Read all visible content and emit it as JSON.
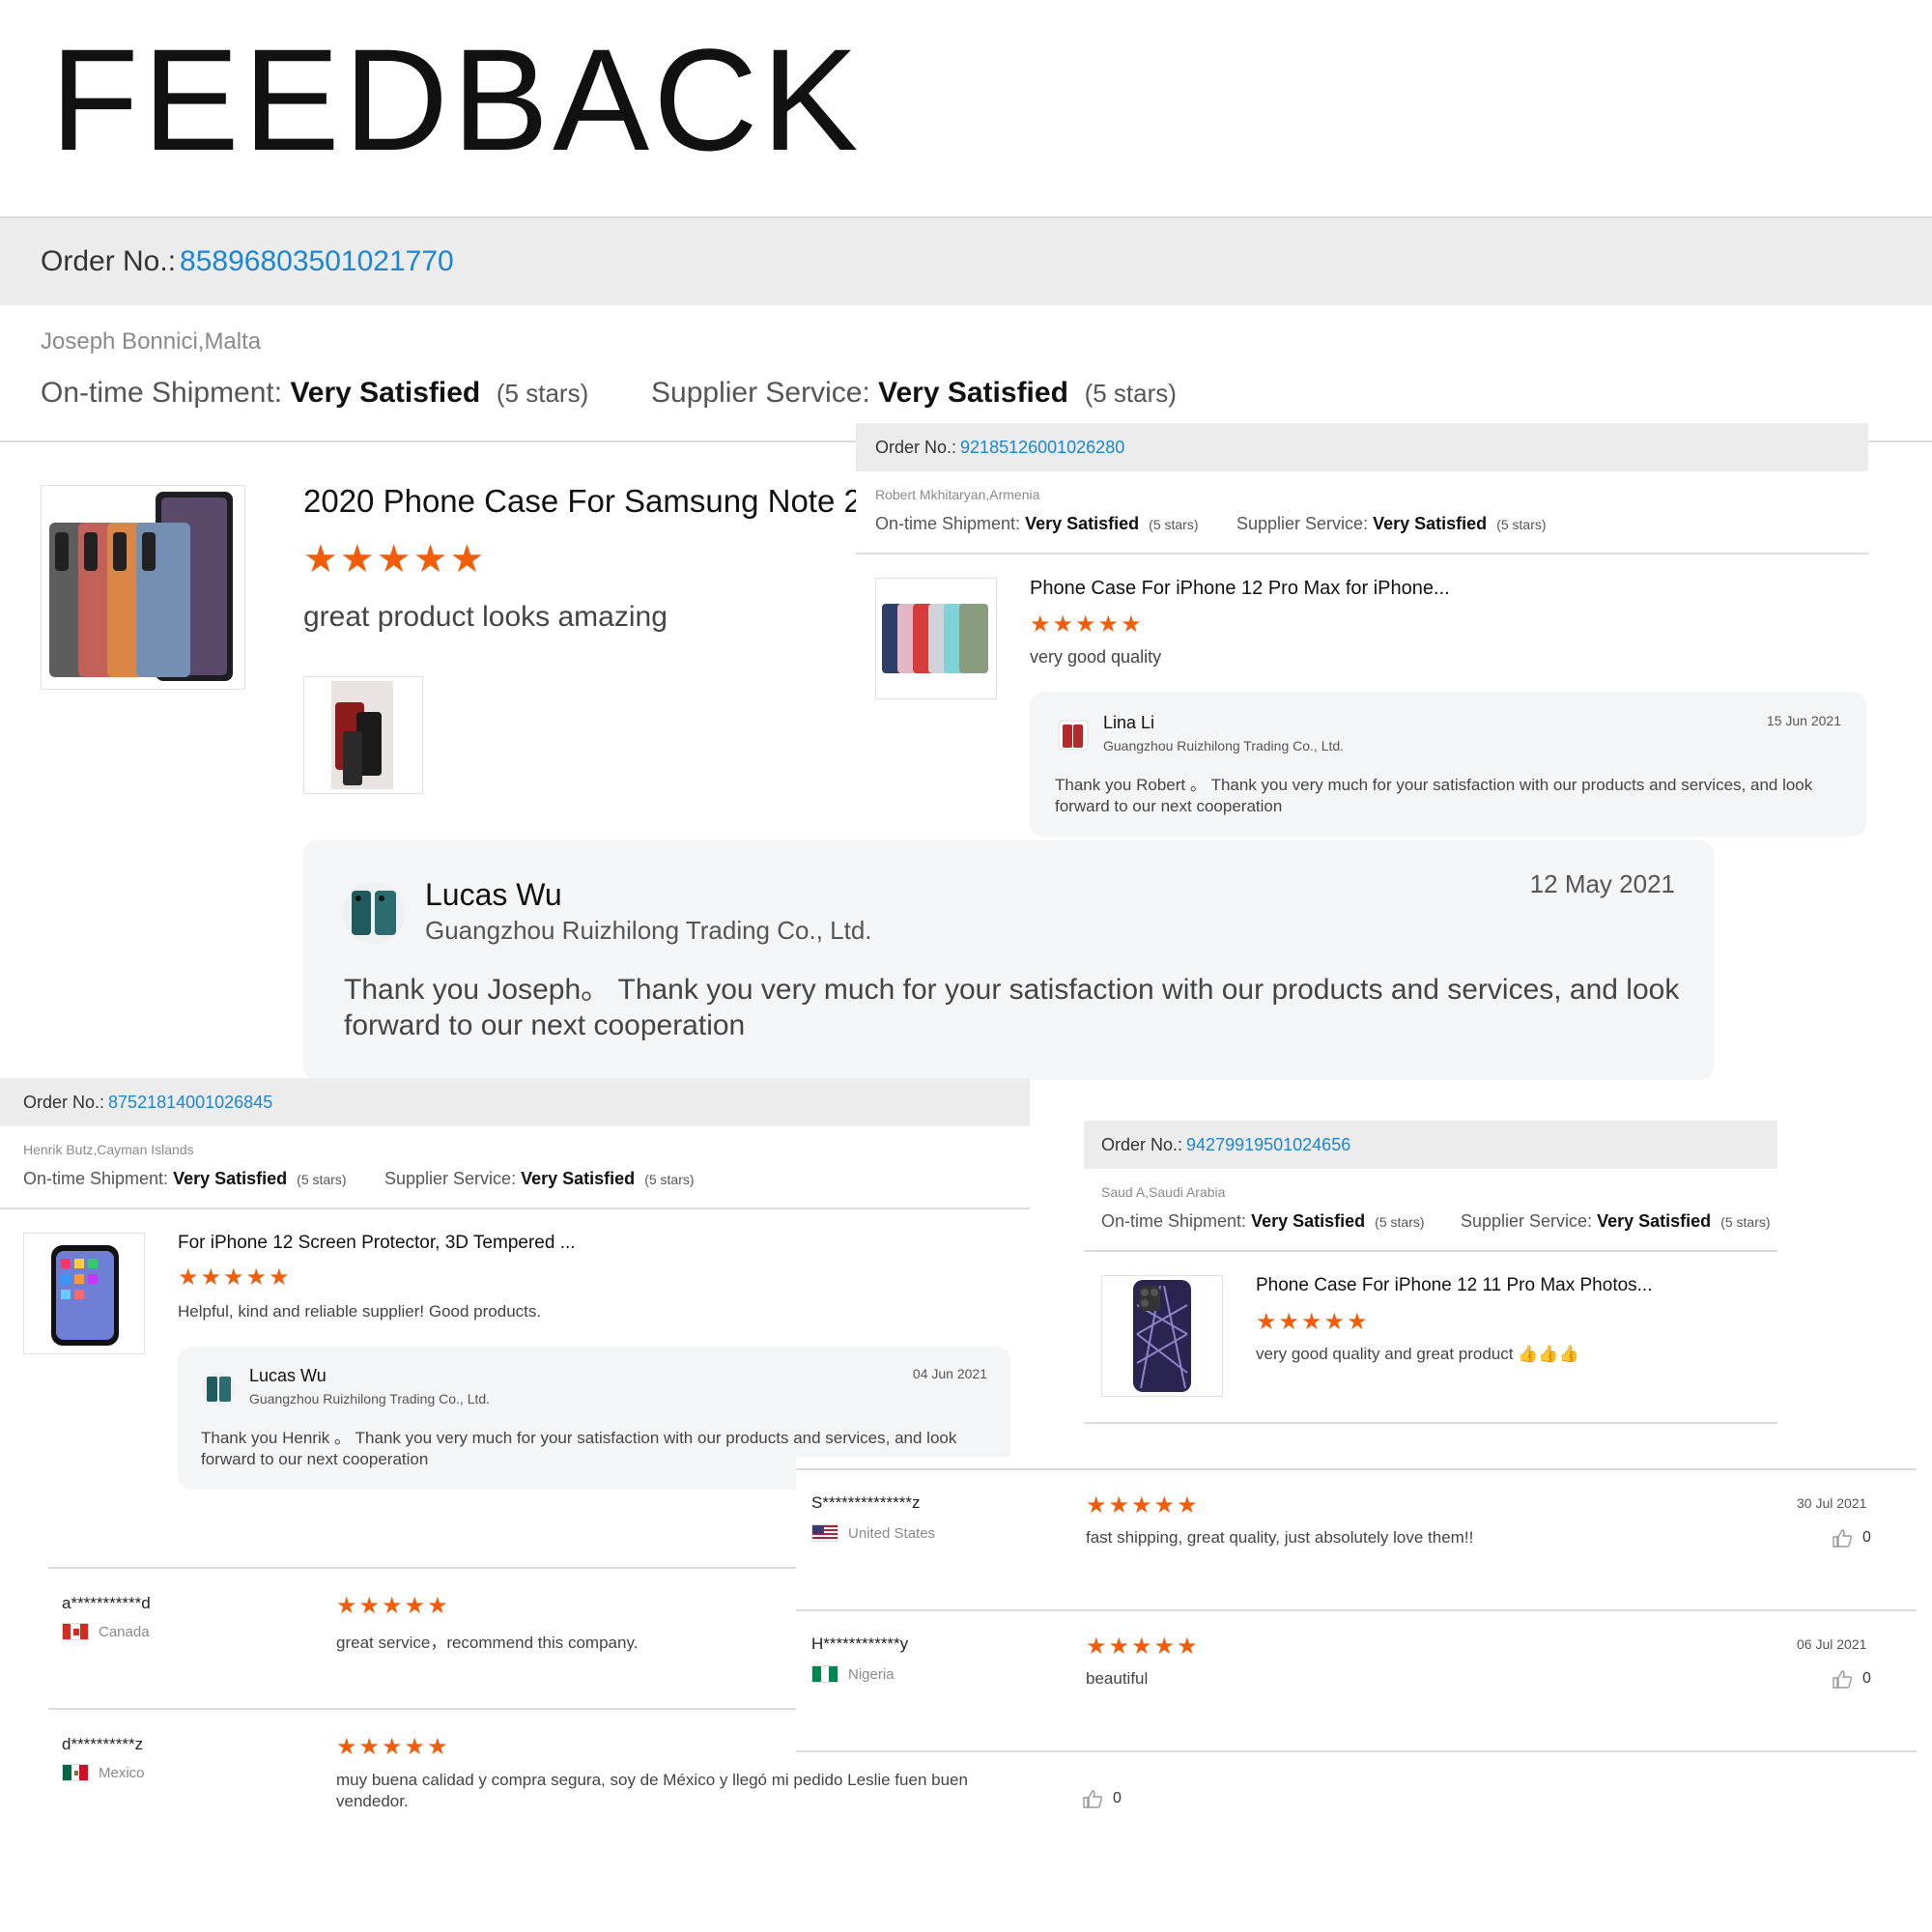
{
  "title": "FEEDBACK",
  "order_label": "Order No.:",
  "satisfied": "Very Satisfied",
  "stars_text": "(5 stars)",
  "ontime_label": "On-time Shipment:",
  "supplier_label": "Supplier Service:",
  "colors": {
    "accent": "#1a86d6",
    "star": "#f25d0b",
    "bar": "#ececec",
    "reply_bg": "#f4f5f7"
  },
  "main": {
    "order_no": "85896803501021770",
    "buyer": "Joseph Bonnici,Malta",
    "product": "2020 Phone Case For Samsung Note 2",
    "rating": 5,
    "review": "great product looks amazing",
    "reply": {
      "name": "Lucas Wu",
      "company": "Guangzhou Ruizhilong Trading Co., Ltd.",
      "date": "12 May 2021",
      "message": "Thank you Joseph。 Thank you very much for your satisfaction with our products and services, and look forward to our next cooperation"
    }
  },
  "card_robert": {
    "order_no": "92185126001026280",
    "buyer": "Robert Mkhitaryan,Armenia",
    "product": "Phone Case For iPhone 12 Pro Max for iPhone...",
    "rating": 5,
    "review": "very good quality",
    "reply": {
      "name": "Lina Li",
      "company": "Guangzhou Ruizhilong Trading Co., Ltd.",
      "date": "15 Jun 2021",
      "message": "Thank you Robert 。 Thank you very much for your satisfaction with our products and services, and look forward to our next cooperation"
    }
  },
  "card_henrik": {
    "order_no": "87521814001026845",
    "buyer": "Henrik Butz,Cayman Islands",
    "product": "For iPhone 12 Screen Protector, 3D Tempered ...",
    "rating": 5,
    "review": "Helpful, kind and reliable supplier! Good products.",
    "reply": {
      "name": "Lucas Wu",
      "company": "Guangzhou Ruizhilong Trading Co., Ltd.",
      "date": "04 Jun 2021",
      "message": "Thank you Henrik 。 Thank you very much for your satisfaction with our products and services, and look forward to our next cooperation"
    }
  },
  "card_saud": {
    "order_no": "94279919501024656",
    "buyer": "Saud A,Saudi Arabia",
    "product": "Phone Case For iPhone 12 11 Pro Max Photos...",
    "rating": 5,
    "review": "very good quality and great product 👍👍👍"
  },
  "reviews_left": [
    {
      "name": "a***********d",
      "country": "Canada",
      "rating": 5,
      "text": "great service，recommend this company."
    },
    {
      "name": "d**********z",
      "country": "Mexico",
      "rating": 5,
      "text": "muy buena calidad y compra segura, soy de México y llegó mi pedido Leslie fuen buen vendedor."
    }
  ],
  "reviews_right": [
    {
      "name": "S**************z",
      "country": "United States",
      "rating": 5,
      "date": "30 Jul 2021",
      "text": "fast shipping, great quality, just absolutely love them!!",
      "likes": "0"
    },
    {
      "name": "H************y",
      "country": "Nigeria",
      "rating": 5,
      "date": "06 Jul 2021",
      "text": "beautiful",
      "likes": "0"
    }
  ],
  "bottom_likes": "0",
  "icons": [
    "star-icon",
    "thumbs-up-icon",
    "flag-canada-icon",
    "flag-mexico-icon",
    "flag-us-icon",
    "flag-nigeria-icon",
    "avatar-phone-icon"
  ]
}
